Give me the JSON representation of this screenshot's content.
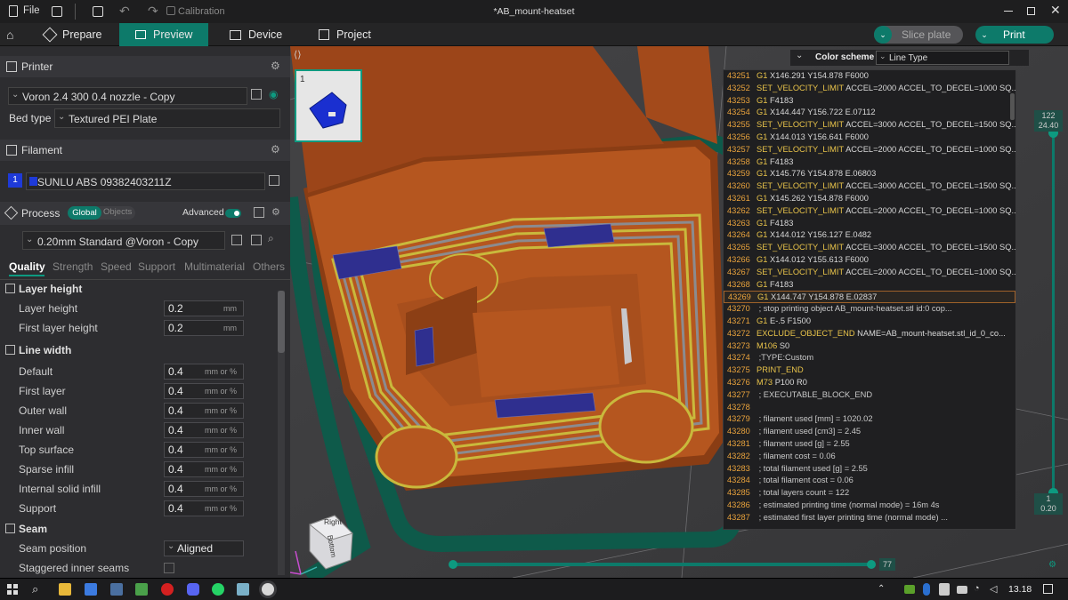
{
  "titlebar": {
    "file_label": "File",
    "calibration_label": "Calibration",
    "doc_title": "*AB_mount-heatset"
  },
  "tabs": {
    "prepare": "Prepare",
    "preview": "Preview",
    "device": "Device",
    "project": "Project"
  },
  "actions": {
    "slice_plate": "Slice plate",
    "print": "Print"
  },
  "printer": {
    "section": "Printer",
    "name": "Voron 2.4 300 0.4 nozzle - Copy",
    "bed_type_label": "Bed type",
    "bed_type": "Textured PEI Plate"
  },
  "filament": {
    "section": "Filament",
    "slot": "1",
    "name": "SUNLU ABS 09382403211Z"
  },
  "process": {
    "section": "Process",
    "global": "Global",
    "objects": "Objects",
    "advanced": "Advanced",
    "preset": "0.20mm Standard @Voron - Copy"
  },
  "subtabs": [
    "Quality",
    "Strength",
    "Speed",
    "Support",
    "Multimaterial",
    "Others"
  ],
  "groups": {
    "layer_height": {
      "title": "Layer height",
      "rows": [
        {
          "label": "Layer height",
          "value": "0.2",
          "unit": "mm"
        },
        {
          "label": "First layer height",
          "value": "0.2",
          "unit": "mm"
        }
      ]
    },
    "line_width": {
      "title": "Line width",
      "rows": [
        {
          "label": "Default",
          "value": "0.4",
          "unit": "mm or %"
        },
        {
          "label": "First layer",
          "value": "0.4",
          "unit": "mm or %"
        },
        {
          "label": "Outer wall",
          "value": "0.4",
          "unit": "mm or %"
        },
        {
          "label": "Inner wall",
          "value": "0.4",
          "unit": "mm or %"
        },
        {
          "label": "Top surface",
          "value": "0.4",
          "unit": "mm or %"
        },
        {
          "label": "Sparse infill",
          "value": "0.4",
          "unit": "mm or %"
        },
        {
          "label": "Internal solid infill",
          "value": "0.4",
          "unit": "mm or %"
        },
        {
          "label": "Support",
          "value": "0.4",
          "unit": "mm or %"
        }
      ]
    },
    "seam": {
      "title": "Seam",
      "rows": [
        {
          "label": "Seam position",
          "value": "Aligned"
        },
        {
          "label": "Staggered inner seams"
        }
      ]
    }
  },
  "viewport": {
    "plate_number": "1",
    "color_scheme_label": "Color scheme",
    "color_scheme_value": "Line Type",
    "layer_top": "122",
    "layer_top_height": "24.40",
    "layer_bottom": "1",
    "layer_bottom_height": "0.20",
    "move_value": "77",
    "cube_right": "Right",
    "cube_bottom": "Bottom"
  },
  "gcode": [
    {
      "n": "43251",
      "c": "G1",
      "t": "X146.291 Y154.878 F6000"
    },
    {
      "n": "43252",
      "c": "SET_VELOCITY_LIMIT",
      "t": "ACCEL=2000 ACCEL_TO_DECEL=1000 SQ..."
    },
    {
      "n": "43253",
      "c": "G1",
      "t": "F4183"
    },
    {
      "n": "43254",
      "c": "G1",
      "t": "X144.447 Y156.722 E.07112"
    },
    {
      "n": "43255",
      "c": "SET_VELOCITY_LIMIT",
      "t": "ACCEL=3000 ACCEL_TO_DECEL=1500 SQ..."
    },
    {
      "n": "43256",
      "c": "G1",
      "t": "X144.013 Y156.641 F6000"
    },
    {
      "n": "43257",
      "c": "SET_VELOCITY_LIMIT",
      "t": "ACCEL=2000 ACCEL_TO_DECEL=1000 SQ..."
    },
    {
      "n": "43258",
      "c": "G1",
      "t": "F4183"
    },
    {
      "n": "43259",
      "c": "G1",
      "t": "X145.776 Y154.878 E.06803"
    },
    {
      "n": "43260",
      "c": "SET_VELOCITY_LIMIT",
      "t": "ACCEL=3000 ACCEL_TO_DECEL=1500 SQ..."
    },
    {
      "n": "43261",
      "c": "G1",
      "t": "X145.262 Y154.878 F6000"
    },
    {
      "n": "43262",
      "c": "SET_VELOCITY_LIMIT",
      "t": "ACCEL=2000 ACCEL_TO_DECEL=1000 SQ..."
    },
    {
      "n": "43263",
      "c": "G1",
      "t": "F4183"
    },
    {
      "n": "43264",
      "c": "G1",
      "t": "X144.012 Y156.127 E.0482"
    },
    {
      "n": "43265",
      "c": "SET_VELOCITY_LIMIT",
      "t": "ACCEL=3000 ACCEL_TO_DECEL=1500 SQ..."
    },
    {
      "n": "43266",
      "c": "G1",
      "t": "X144.012 Y155.613 F6000"
    },
    {
      "n": "43267",
      "c": "SET_VELOCITY_LIMIT",
      "t": "ACCEL=2000 ACCEL_TO_DECEL=1000 SQ..."
    },
    {
      "n": "43268",
      "c": "G1",
      "t": "F4183"
    },
    {
      "n": "43269",
      "c": "G1",
      "t": "X144.747 Y154.878 E.02837"
    },
    {
      "n": "43270",
      "c": "",
      "t": "; stop printing object AB_mount-heatset.stl id:0 cop..."
    },
    {
      "n": "43271",
      "c": "G1",
      "t": "E-.5 F1500"
    },
    {
      "n": "43272",
      "c": "EXCLUDE_OBJECT_END",
      "t": "NAME=AB_mount-heatset.stl_id_0_co..."
    },
    {
      "n": "43273",
      "c": "M106",
      "t": "S0"
    },
    {
      "n": "43274",
      "c": "",
      "t": ";TYPE:Custom"
    },
    {
      "n": "43275",
      "c": "PRINT_END",
      "t": ""
    },
    {
      "n": "43276",
      "c": "M73",
      "t": "P100 R0"
    },
    {
      "n": "43277",
      "c": "",
      "t": "; EXECUTABLE_BLOCK_END"
    },
    {
      "n": "43278",
      "c": "",
      "t": ""
    },
    {
      "n": "43279",
      "c": "",
      "t": "; filament used [mm] = 1020.02"
    },
    {
      "n": "43280",
      "c": "",
      "t": "; filament used [cm3] = 2.45"
    },
    {
      "n": "43281",
      "c": "",
      "t": "; filament used [g] = 2.55"
    },
    {
      "n": "43282",
      "c": "",
      "t": "; filament cost = 0.06"
    },
    {
      "n": "43283",
      "c": "",
      "t": "; total filament used [g] = 2.55"
    },
    {
      "n": "43284",
      "c": "",
      "t": "; total filament cost = 0.06"
    },
    {
      "n": "43285",
      "c": "",
      "t": "; total layers count = 122"
    },
    {
      "n": "43286",
      "c": "",
      "t": "; estimated printing time (normal mode) = 16m 4s"
    },
    {
      "n": "43287",
      "c": "",
      "t": "; estimated first layer printing time (normal mode) ..."
    }
  ],
  "taskbar": {
    "time": "13.18"
  },
  "colors": {
    "accent": "#0d7a6a",
    "print_orange": "#b5561f",
    "infill_yellow": "#c9b93c",
    "top_blue": "#2f2f8f",
    "skirt_green": "#0e5a4a"
  }
}
